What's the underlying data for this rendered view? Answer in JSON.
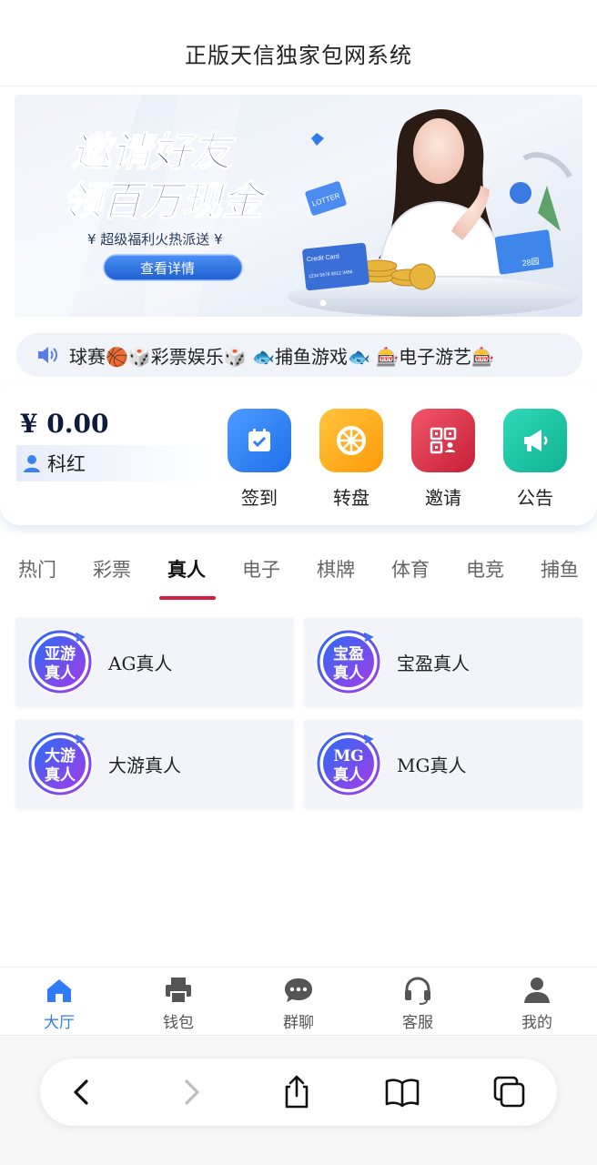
{
  "header": {
    "title": "正版天信独家包网系统"
  },
  "banner": {
    "headline_line1": "邀请好友",
    "headline_line2": "领百万现金",
    "subline": "¥ 超级福利火热派送 ¥",
    "button_label": "查看详情",
    "card_label": "Credit Card",
    "card_number": "1234 5678 9012 3456",
    "ticket_label": "LOTTER",
    "envelope_label": "28园"
  },
  "marquee": {
    "text": "球赛🏀🎲彩票娱乐🎲 🐟捕鱼游戏🐟 🎰电子游艺🎰"
  },
  "user": {
    "balance": "¥ 0.00",
    "name": "科红",
    "actions": [
      {
        "label": "签到",
        "icon": "calendar-check-icon",
        "color": "#2f7cf6"
      },
      {
        "label": "转盘",
        "icon": "wheel-icon",
        "color": "#ffac1a"
      },
      {
        "label": "邀请",
        "icon": "qr-code-icon",
        "color": "#de3146"
      },
      {
        "label": "公告",
        "icon": "megaphone-icon",
        "color": "#18c4a6"
      }
    ]
  },
  "tabs": {
    "items": [
      "热门",
      "彩票",
      "真人",
      "电子",
      "棋牌",
      "体育",
      "电竞",
      "捕鱼"
    ],
    "active_index": 2,
    "accent": "#d81e3c"
  },
  "games": [
    {
      "logo_line1": "亚游",
      "logo_line2": "真人",
      "name": "AG真人"
    },
    {
      "logo_line1": "宝盈",
      "logo_line2": "真人",
      "name": "宝盈真人"
    },
    {
      "logo_line1": "大游",
      "logo_line2": "真人",
      "name": "大游真人"
    },
    {
      "logo_line1": "MG",
      "logo_line2": "真人",
      "name": "MG真人"
    }
  ],
  "tabbar": {
    "items": [
      {
        "label": "大厅",
        "icon": "home-icon",
        "active": true
      },
      {
        "label": "钱包",
        "icon": "printer-icon",
        "active": false
      },
      {
        "label": "群聊",
        "icon": "chat-bubble-icon",
        "active": false
      },
      {
        "label": "客服",
        "icon": "headset-icon",
        "active": false
      },
      {
        "label": "我的",
        "icon": "person-icon",
        "active": false
      }
    ],
    "active_color": "#2f7cf6"
  },
  "browser": {
    "buttons": [
      "back-icon",
      "forward-icon",
      "share-icon",
      "bookmarks-icon",
      "tabs-icon"
    ]
  }
}
